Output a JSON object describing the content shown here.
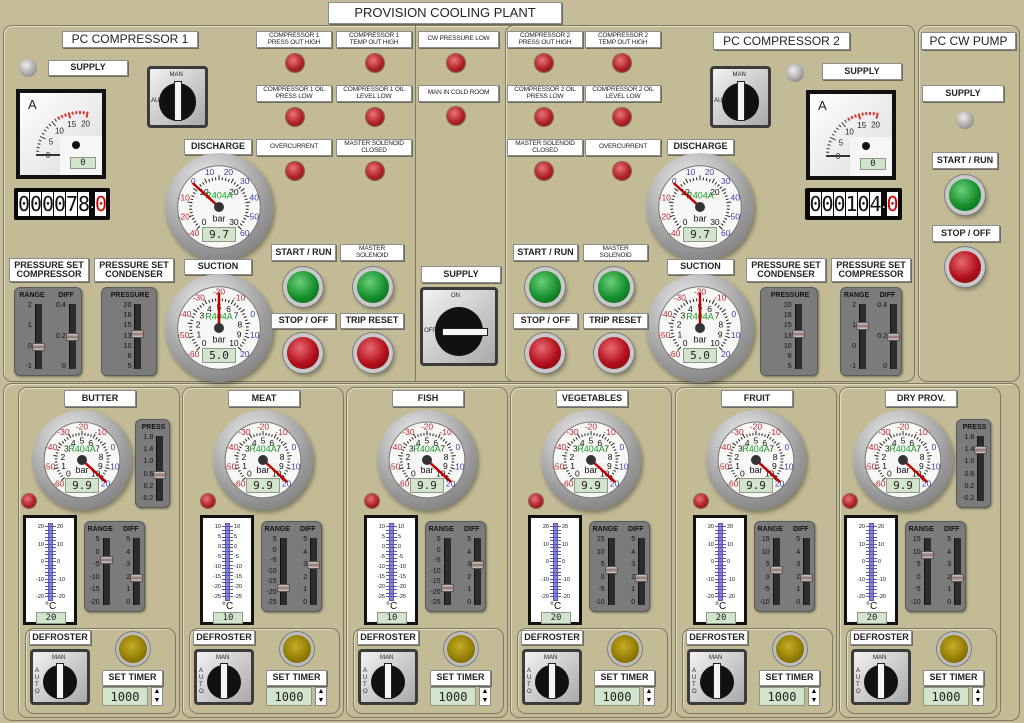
{
  "title": "PROVISION COOLING PLANT",
  "colors": {
    "panel": "#c3bb96",
    "alarm_lamp": "#b12229",
    "start_button": "#17902d",
    "stop_button": "#b3101c",
    "defrost_lamp": "#8b7600",
    "refrigerant_text": "#1a9b2a",
    "needle": "#c00000"
  },
  "compressor1": {
    "title": "PC COMPRESSOR 1",
    "supply_label": "SUPPLY",
    "supply_lamp": "off",
    "ammeter": {
      "unit": "A",
      "scale": [
        "0",
        "5",
        "10",
        "15",
        "20"
      ],
      "value": "0"
    },
    "counter": {
      "digits": [
        "0",
        "0",
        "0",
        "0",
        "7",
        "8"
      ],
      "decimal": "0"
    },
    "mode_switch": {
      "man": "MAN",
      "aut": "AUT",
      "position": "MAN"
    },
    "alarms": [
      {
        "label": "COMPRESSOR 1\nPRESS OUT HIGH"
      },
      {
        "label": "COMPRESSOR 1\nTEMP OUT HIGH"
      },
      {
        "label": "COMPRESSOR 1 OIL\nPRESS LOW"
      },
      {
        "label": "COMPRESSOR 1 OIL\nLEVEL LOW"
      },
      {
        "label": "OVERCURRENT"
      },
      {
        "label": "MASTER SOLENOID\nCLOSED"
      }
    ],
    "discharge": {
      "label": "DISCHARGE",
      "gauge": {
        "refrigerant": "R404A",
        "unit": "bar",
        "value": "9.7",
        "reading": 9.7,
        "inner_scale": [
          "0",
          "10",
          "20",
          "30"
        ],
        "outer_scale": [
          "-40",
          "-20",
          "-10",
          "0",
          "10",
          "20",
          "30",
          "40",
          "50",
          "60"
        ]
      }
    },
    "suction": {
      "label": "SUCTION",
      "gauge": {
        "refrigerant": "R404A",
        "unit": "bar",
        "value": "5.0",
        "reading": 5.0,
        "inner_scale": [
          "0",
          "1",
          "2",
          "3",
          "4",
          "5",
          "6",
          "7",
          "8",
          "9",
          "10"
        ],
        "outer_scale": [
          "-60",
          "-50",
          "-40",
          "-30",
          "-20",
          "-10",
          "0",
          "10",
          "20"
        ]
      }
    },
    "buttons": {
      "start_run": "START / RUN",
      "master_solenoid": "MASTER\nSOLENOID",
      "stop_off": "STOP / OFF",
      "trip_reset": "TRIP RESET"
    },
    "pressure_set_compressor": {
      "label": "PRESSURE SET\nCOMPRESSOR",
      "range_label": "RANGE",
      "diff_label": "DIFF",
      "range_scale": [
        "2",
        "1",
        "0",
        "-1"
      ],
      "diff_scale": [
        "0.4",
        "0.2",
        "0"
      ],
      "range_value": 0,
      "diff_value": 0.2
    },
    "pressure_set_condenser": {
      "label": "PRESSURE SET\nCONDENSER",
      "pressure_label": "PRESSURE",
      "scale": [
        "20",
        "18",
        "15",
        "13",
        "10",
        "8",
        "5"
      ],
      "value": 13
    }
  },
  "common": {
    "alarms": [
      {
        "label": "CW PRESSURE LOW"
      },
      {
        "label": "MAN IN COLD ROOM"
      }
    ],
    "supply_label": "SUPPLY",
    "supply_switch": {
      "on": "ON",
      "off": "OFF",
      "position": "OFF"
    }
  },
  "compressor2": {
    "title": "PC COMPRESSOR 2",
    "supply_label": "SUPPLY",
    "supply_lamp": "off",
    "ammeter": {
      "unit": "A",
      "scale": [
        "0",
        "5",
        "10",
        "15",
        "20"
      ],
      "value": "0"
    },
    "counter": {
      "digits": [
        "0",
        "0",
        "0",
        "1",
        "0",
        "4"
      ],
      "decimal": "0"
    },
    "mode_switch": {
      "man": "MAN",
      "aut": "AUT",
      "position": "MAN"
    },
    "alarms": [
      {
        "label": "COMPRESSOR 2\nPRESS OUT HIGH"
      },
      {
        "label": "COMPRESSOR 2\nTEMP OUT HIGH"
      },
      {
        "label": "COMPRESSOR 2 OIL\nPRESS LOW"
      },
      {
        "label": "COMPRESSOR 2  OIL\nLEVEL LOW"
      },
      {
        "label": "MASTER SOLENOID\nCLOSED"
      },
      {
        "label": "OVERCURRENT"
      }
    ],
    "discharge": {
      "label": "DISCHARGE",
      "gauge": {
        "refrigerant": "R404A",
        "unit": "bar",
        "value": "9.7",
        "reading": 9.7,
        "inner_scale": [
          "0",
          "10",
          "20",
          "30"
        ],
        "outer_scale": [
          "-40",
          "-20",
          "-10",
          "0",
          "10",
          "20",
          "30",
          "40",
          "50",
          "60"
        ]
      }
    },
    "suction": {
      "label": "SUCTION",
      "gauge": {
        "refrigerant": "R404A",
        "unit": "bar",
        "value": "5.0",
        "reading": 5.0,
        "inner_scale": [
          "0",
          "1",
          "2",
          "3",
          "4",
          "5",
          "6",
          "7",
          "8",
          "9",
          "10"
        ],
        "outer_scale": [
          "-60",
          "-50",
          "-40",
          "-30",
          "-20",
          "-10",
          "0",
          "10",
          "20"
        ]
      }
    },
    "buttons": {
      "start_run": "START / RUN",
      "master_solenoid": "MASTER\nSOLENOID",
      "stop_off": "STOP / OFF",
      "trip_reset": "TRIP RESET"
    },
    "pressure_set_condenser": {
      "label": "PRESSURE SET\nCONDENSER",
      "pressure_label": "PRESSURE",
      "scale": [
        "20",
        "18",
        "15",
        "13",
        "10",
        "8",
        "5"
      ],
      "value": 13
    },
    "pressure_set_compressor": {
      "label": "PRESSURE SET\nCOMPRESSOR",
      "range_label": "RANGE",
      "diff_label": "DIFF",
      "range_scale": [
        "2",
        "1",
        "0",
        "-1"
      ],
      "diff_scale": [
        "0.4",
        "0.2",
        "0"
      ],
      "range_value": 1,
      "diff_value": 0.2
    }
  },
  "cw_pump": {
    "title": "PC CW PUMP",
    "supply_label": "SUPPLY",
    "supply_lamp": "off",
    "start_run": "START / RUN",
    "stop_off": "STOP / OFF"
  },
  "rooms": [
    {
      "name": "BUTTER",
      "gauge": {
        "refrigerant": "R404A",
        "unit": "bar",
        "value": "9.9",
        "reading": 9.9,
        "inner_scale": [
          "0",
          "1",
          "2",
          "3",
          "4",
          "5",
          "6",
          "7",
          "8",
          "9",
          "10"
        ],
        "outer_scale": [
          "-60",
          "-50",
          "-40",
          "-30",
          "-20",
          "-10",
          "0",
          "10",
          "20"
        ]
      },
      "press": {
        "label": "PRESS",
        "scale": [
          "1.8",
          "1.4",
          "1.0",
          "0.6",
          "0.2",
          "-0.2"
        ],
        "value": 0.6
      },
      "thermo": {
        "scale": [
          "20",
          "10",
          "0",
          "-10",
          "-20"
        ],
        "unit": "°C",
        "value": "20"
      },
      "range_diff": {
        "range_label": "RANGE",
        "diff_label": "DIFF",
        "range_scale": [
          "5",
          "0",
          "-5",
          "-10",
          "-15",
          "-20"
        ],
        "diff_scale": [
          "5",
          "4",
          "3",
          "2",
          "1",
          "0"
        ],
        "range_value": -3,
        "diff_value": 2
      },
      "defroster": {
        "label": "DEFROSTER",
        "man": "MAN",
        "auto": "AUTO",
        "timer_label": "SET TIMER",
        "timer_value": "1000"
      }
    },
    {
      "name": "MEAT",
      "gauge": {
        "refrigerant": "R404A",
        "unit": "bar",
        "value": "9.9",
        "reading": 9.9,
        "inner_scale": [
          "0",
          "1",
          "2",
          "3",
          "4",
          "5",
          "6",
          "7",
          "8",
          "9",
          "10"
        ],
        "outer_scale": [
          "-60",
          "-50",
          "-40",
          "-30",
          "-20",
          "-10",
          "0",
          "10",
          "20"
        ]
      },
      "thermo": {
        "scale": [
          "10",
          "5",
          "0",
          "-5",
          "-10",
          "-15",
          "-20",
          "-25"
        ],
        "unit": "°C",
        "value": "10"
      },
      "range_diff": {
        "range_label": "RANGE",
        "diff_label": "DIFF",
        "range_scale": [
          "5",
          "0",
          "-5",
          "-10",
          "-15",
          "-20",
          "-25"
        ],
        "diff_scale": [
          "5",
          "4",
          "3",
          "2",
          "1",
          "0"
        ],
        "range_value": -18,
        "diff_value": 3
      },
      "defroster": {
        "label": "DEFROSTER",
        "man": "MAN",
        "auto": "AUTO",
        "timer_label": "SET TIMER",
        "timer_value": "1000"
      }
    },
    {
      "name": "FISH",
      "gauge": {
        "refrigerant": "R404A",
        "unit": "bar",
        "value": "9.9",
        "reading": 9.9,
        "inner_scale": [
          "0",
          "1",
          "2",
          "3",
          "4",
          "5",
          "6",
          "7",
          "8",
          "9",
          "10"
        ],
        "outer_scale": [
          "-60",
          "-50",
          "-40",
          "-30",
          "-20",
          "-10",
          "0",
          "10",
          "20"
        ]
      },
      "thermo": {
        "scale": [
          "10",
          "5",
          "0",
          "-5",
          "-10",
          "-15",
          "-20",
          "-25"
        ],
        "unit": "°C",
        "value": "10"
      },
      "range_diff": {
        "range_label": "RANGE",
        "diff_label": "DIFF",
        "range_scale": [
          "5",
          "0",
          "-5",
          "-10",
          "-15",
          "-20",
          "-25"
        ],
        "diff_scale": [
          "5",
          "4",
          "3",
          "2",
          "1",
          "0"
        ],
        "range_value": -18,
        "diff_value": 3
      },
      "defroster": {
        "label": "DEFROSTER",
        "man": "MAN",
        "auto": "AUTO",
        "timer_label": "SET TIMER",
        "timer_value": "1000"
      }
    },
    {
      "name": "VEGETABLES",
      "gauge": {
        "refrigerant": "R404A",
        "unit": "bar",
        "value": "9.9",
        "reading": 9.9,
        "inner_scale": [
          "0",
          "1",
          "2",
          "3",
          "4",
          "5",
          "6",
          "7",
          "8",
          "9",
          "10"
        ],
        "outer_scale": [
          "-60",
          "-50",
          "-40",
          "-30",
          "-20",
          "-10",
          "0",
          "10",
          "20"
        ]
      },
      "thermo": {
        "scale": [
          "20",
          "10",
          "0",
          "-10",
          "-20"
        ],
        "unit": "°C",
        "value": "20"
      },
      "range_diff": {
        "range_label": "RANGE",
        "diff_label": "DIFF",
        "range_scale": [
          "15",
          "10",
          "5",
          "0",
          "-5",
          "-10"
        ],
        "diff_scale": [
          "5",
          "4",
          "3",
          "2",
          "1",
          "0"
        ],
        "range_value": 3,
        "diff_value": 2
      },
      "defroster": {
        "label": "DEFROSTER",
        "man": "MAN",
        "auto": "AUTO",
        "timer_label": "SET TIMER",
        "timer_value": "1000"
      }
    },
    {
      "name": "FRUIT",
      "gauge": {
        "refrigerant": "R404A",
        "unit": "bar",
        "value": "9.9",
        "reading": 9.9,
        "inner_scale": [
          "0",
          "1",
          "2",
          "3",
          "4",
          "5",
          "6",
          "7",
          "8",
          "9",
          "10"
        ],
        "outer_scale": [
          "-60",
          "-50",
          "-40",
          "-30",
          "-20",
          "-10",
          "0",
          "10",
          "20"
        ]
      },
      "thermo": {
        "scale": [
          "20",
          "10",
          "0",
          "-10",
          "-20"
        ],
        "unit": "°C",
        "value": "20"
      },
      "range_diff": {
        "range_label": "RANGE",
        "diff_label": "DIFF",
        "range_scale": [
          "15",
          "10",
          "5",
          "0",
          "-5",
          "-10"
        ],
        "diff_scale": [
          "5",
          "4",
          "3",
          "2",
          "1",
          "0"
        ],
        "range_value": 3,
        "diff_value": 2
      },
      "defroster": {
        "label": "DEFROSTER",
        "man": "MAN",
        "auto": "AUTO",
        "timer_label": "SET TIMER",
        "timer_value": "1000"
      }
    },
    {
      "name": "DRY PROV.",
      "gauge": {
        "refrigerant": "R404A",
        "unit": "bar",
        "value": "9.9",
        "reading": 9.9,
        "inner_scale": [
          "0",
          "1",
          "2",
          "3",
          "4",
          "5",
          "6",
          "7",
          "8",
          "9",
          "10"
        ],
        "outer_scale": [
          "-60",
          "-50",
          "-40",
          "-30",
          "-20",
          "-10",
          "0",
          "10",
          "20"
        ]
      },
      "press": {
        "label": "PRESS",
        "scale": [
          "1.8",
          "1.4",
          "1.0",
          "0.6",
          "0.2",
          "-0.2"
        ],
        "value": 1.4
      },
      "thermo": {
        "scale": [
          "20",
          "10",
          "0",
          "-10",
          "-20"
        ],
        "unit": "°C",
        "value": "20"
      },
      "range_diff": {
        "range_label": "RANGE",
        "diff_label": "DIFF",
        "range_scale": [
          "15",
          "10",
          "5",
          "0",
          "-5",
          "-10"
        ],
        "diff_scale": [
          "5",
          "4",
          "3",
          "2",
          "1",
          "0"
        ],
        "range_value": 9,
        "diff_value": 2
      },
      "defroster": {
        "label": "DEFROSTER",
        "man": "MAN",
        "auto": "AUTO",
        "timer_label": "SET TIMER",
        "timer_value": "1000"
      }
    }
  ]
}
